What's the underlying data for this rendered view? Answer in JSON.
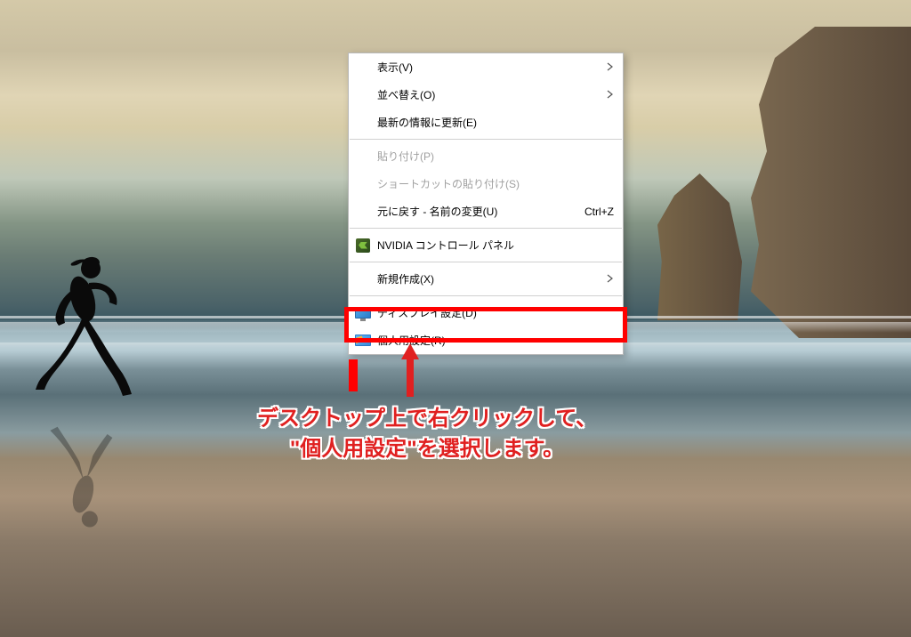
{
  "menu": {
    "items": [
      {
        "label": "表示(V)",
        "has_submenu": true,
        "enabled": true
      },
      {
        "label": "並べ替え(O)",
        "has_submenu": true,
        "enabled": true
      },
      {
        "label": "最新の情報に更新(E)",
        "has_submenu": false,
        "enabled": true
      }
    ],
    "items2": [
      {
        "label": "貼り付け(P)",
        "enabled": false
      },
      {
        "label": "ショートカットの貼り付け(S)",
        "enabled": false
      },
      {
        "label": "元に戻す - 名前の変更(U)",
        "shortcut": "Ctrl+Z",
        "enabled": true
      }
    ],
    "items3": [
      {
        "label": "NVIDIA コントロール パネル",
        "icon": "nvidia",
        "enabled": true
      }
    ],
    "items4": [
      {
        "label": "新規作成(X)",
        "has_submenu": true,
        "enabled": true
      }
    ],
    "items5": [
      {
        "label": "ディスプレイ設定(D)",
        "icon": "display",
        "enabled": true
      },
      {
        "label": "個人用設定(R)",
        "icon": "personalize",
        "enabled": true,
        "highlighted": true
      }
    ]
  },
  "annotation": {
    "line1": "デスクトップ上で右クリックして、",
    "line2": "\"個人用設定\"を選択します。"
  }
}
